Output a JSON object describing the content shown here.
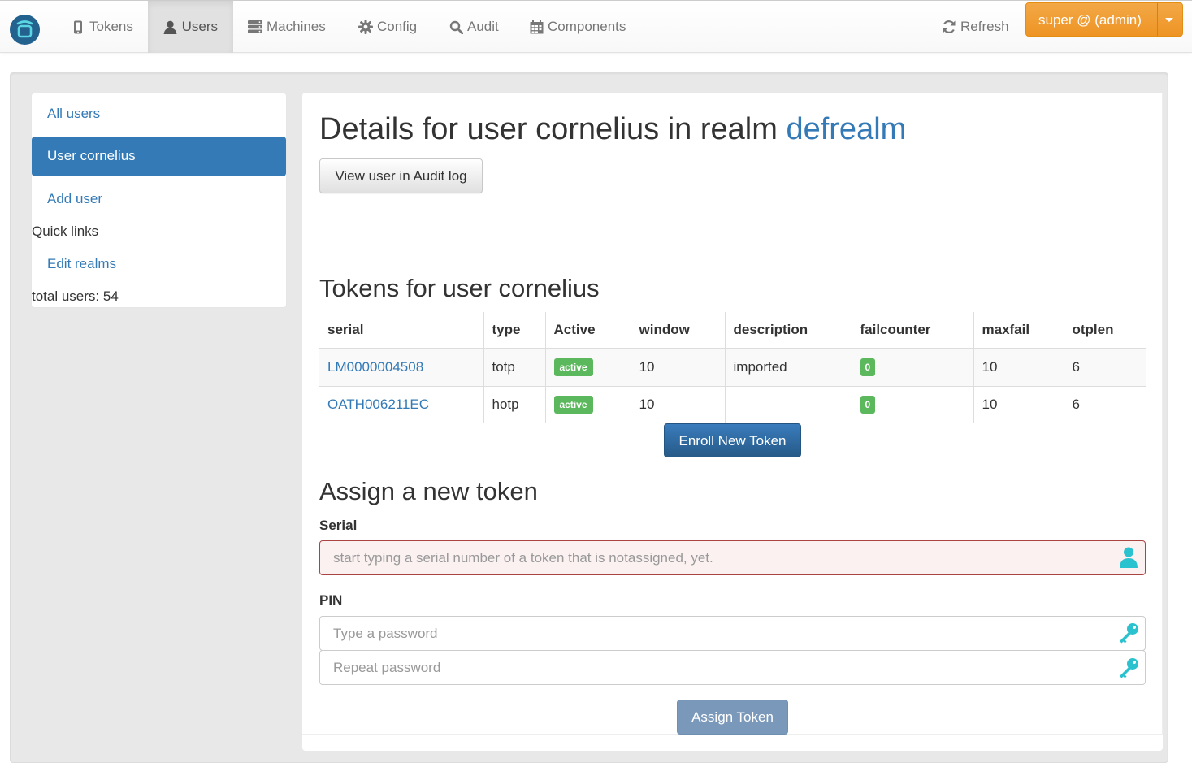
{
  "nav": {
    "items": [
      {
        "label": "Tokens",
        "icon": "phone-icon"
      },
      {
        "label": "Users",
        "icon": "user-icon"
      },
      {
        "label": "Machines",
        "icon": "server-icon"
      },
      {
        "label": "Config",
        "icon": "gear-icon"
      },
      {
        "label": "Audit",
        "icon": "search-icon"
      },
      {
        "label": "Components",
        "icon": "calendar-icon"
      }
    ],
    "active_item": "Users",
    "refresh_label": "Refresh",
    "user_menu_label": "super @ (admin)"
  },
  "sidebar": {
    "all_users": "All users",
    "current_user": "User cornelius",
    "add_user": "Add user",
    "quick_links_label": "Quick links",
    "edit_realms": "Edit realms",
    "total_users": "total users: 54"
  },
  "details": {
    "title_prefix": "Details for user cornelius in realm",
    "realm": "defrealm",
    "audit_button": "View user in Audit log"
  },
  "tokens": {
    "heading": "Tokens for user cornelius",
    "columns": [
      "serial",
      "type",
      "Active",
      "window",
      "description",
      "failcounter",
      "maxfail",
      "otplen"
    ],
    "rows": [
      {
        "serial": "LM0000004508",
        "type": "totp",
        "active": "active",
        "window": "10",
        "description": "imported",
        "failcounter": "0",
        "maxfail": "10",
        "otplen": "6"
      },
      {
        "serial": "OATH006211EC",
        "type": "hotp",
        "active": "active",
        "window": "10",
        "description": "",
        "failcounter": "0",
        "maxfail": "10",
        "otplen": "6"
      }
    ],
    "enroll_button": "Enroll New Token"
  },
  "assign": {
    "heading": "Assign a new token",
    "serial_label": "Serial",
    "serial_placeholder": "start typing a serial number of a token that is notassigned, yet.",
    "pin_label": "PIN",
    "pin_placeholder": "Type a password",
    "pin_repeat_placeholder": "Repeat password",
    "assign_button": "Assign Token"
  },
  "colors": {
    "primary": "#337ab7",
    "user_button": "#f0ad4e",
    "success": "#5cb85c",
    "error_border": "#a94442",
    "icon_teal": "#2bc2cf"
  }
}
